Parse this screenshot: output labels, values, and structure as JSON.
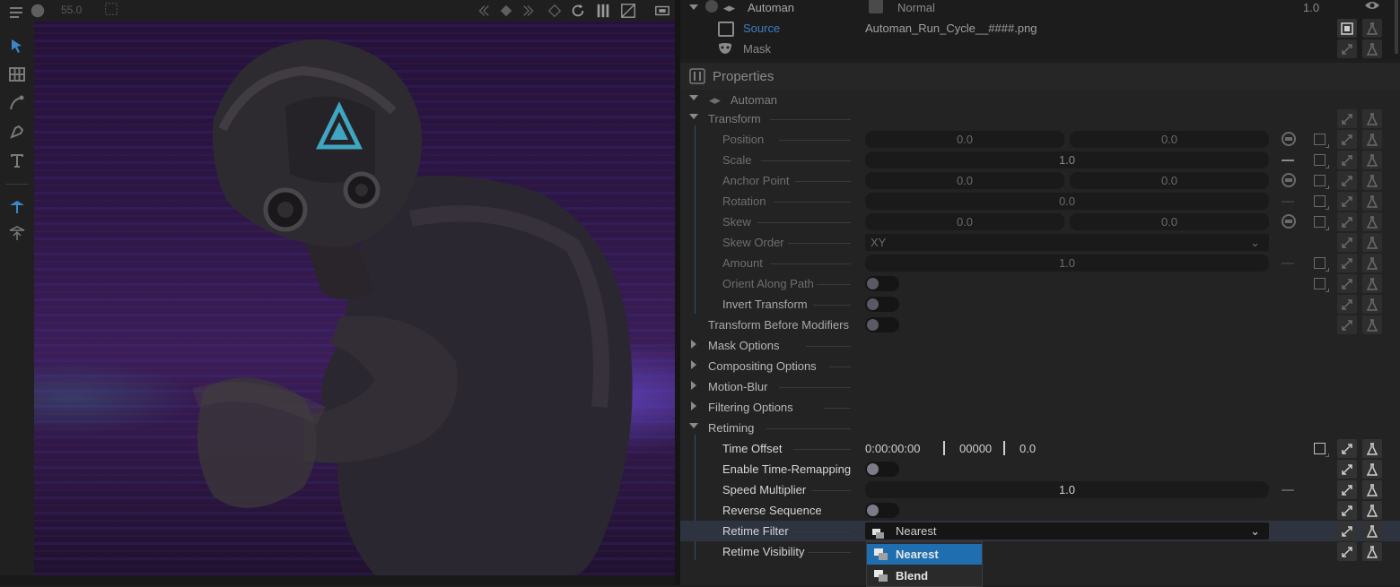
{
  "viewer": {
    "zoom": "55.0"
  },
  "layers": {
    "layer_name": "Automan",
    "blend_mode": "Normal",
    "opacity": "1.0",
    "source_label": "Source",
    "source_file": "Automan_Run_Cycle__####.png",
    "mask_label": "Mask"
  },
  "properties": {
    "title": "Properties",
    "layer_name": "Automan",
    "transform": {
      "label": "Transform",
      "position": {
        "label": "Position",
        "x": "0.0",
        "y": "0.0"
      },
      "scale": {
        "label": "Scale",
        "value": "1.0"
      },
      "anchor_point": {
        "label": "Anchor Point",
        "x": "0.0",
        "y": "0.0"
      },
      "rotation": {
        "label": "Rotation",
        "value": "0.0"
      },
      "skew": {
        "label": "Skew",
        "x": "0.0",
        "y": "0.0"
      },
      "skew_order": {
        "label": "Skew Order",
        "value": "XY"
      },
      "amount": {
        "label": "Amount",
        "value": "1.0"
      },
      "orient_along_path": {
        "label": "Orient Along Path"
      },
      "invert_transform": {
        "label": "Invert Transform"
      }
    },
    "transform_before_modifiers": {
      "label": "Transform Before Modifiers"
    },
    "sections": {
      "mask_options": "Mask Options",
      "compositing_options": "Compositing Options",
      "motion_blur": "Motion-Blur",
      "filtering_options": "Filtering Options"
    },
    "retiming": {
      "label": "Retiming",
      "time_offset": {
        "label": "Time Offset",
        "timecode": "0:00:00:00",
        "frames": "00000",
        "value": "0.0"
      },
      "enable_time_remapping": {
        "label": "Enable Time-Remapping"
      },
      "speed_multiplier": {
        "label": "Speed Multiplier",
        "value": "1.0"
      },
      "reverse_sequence": {
        "label": "Reverse Sequence"
      },
      "retime_filter": {
        "label": "Retime Filter",
        "value": "Nearest",
        "options": [
          "Nearest",
          "Blend"
        ]
      },
      "retime_visibility": {
        "label": "Retime Visibility"
      }
    }
  },
  "colors": {
    "accent": "#1f6fb0",
    "tree_line": "#2f4f70",
    "panel_bg": "#232323"
  }
}
